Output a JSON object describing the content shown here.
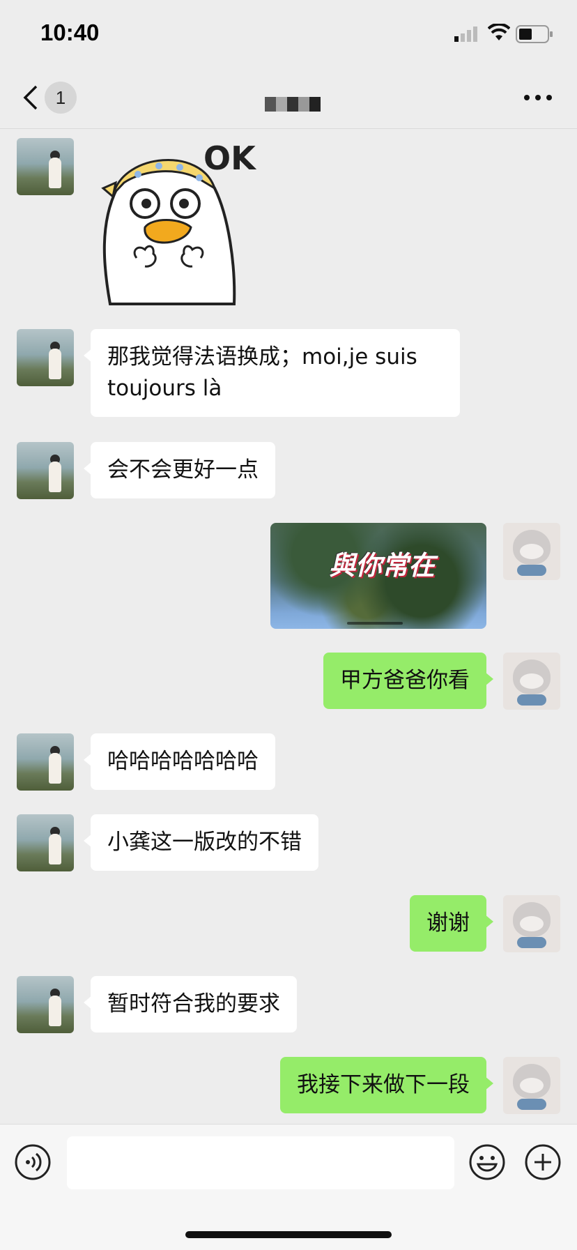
{
  "status_bar": {
    "time": "10:40"
  },
  "nav": {
    "unread_count": "1"
  },
  "messages": [
    {
      "side": "in",
      "type": "sticker",
      "caption": "OK"
    },
    {
      "side": "in",
      "type": "text",
      "text": "那我觉得法语换成；moi,je suis toujours là"
    },
    {
      "side": "in",
      "type": "text",
      "text": "会不会更好一点"
    },
    {
      "side": "out",
      "type": "video",
      "overlay_text": "與你常在"
    },
    {
      "side": "out",
      "type": "text",
      "text": "甲方爸爸你看"
    },
    {
      "side": "in",
      "type": "text",
      "text": "哈哈哈哈哈哈哈"
    },
    {
      "side": "in",
      "type": "text",
      "text": "小龚这一版改的不错"
    },
    {
      "side": "out",
      "type": "text",
      "text": "谢谢"
    },
    {
      "side": "in",
      "type": "text",
      "text": "暂时符合我的要求"
    },
    {
      "side": "out",
      "type": "text",
      "text": "我接下来做下一段"
    }
  ],
  "input_bar": {
    "draft": ""
  },
  "colors": {
    "outgoing_bubble": "#95ec69",
    "incoming_bubble": "#ffffff",
    "background": "#ededed"
  }
}
